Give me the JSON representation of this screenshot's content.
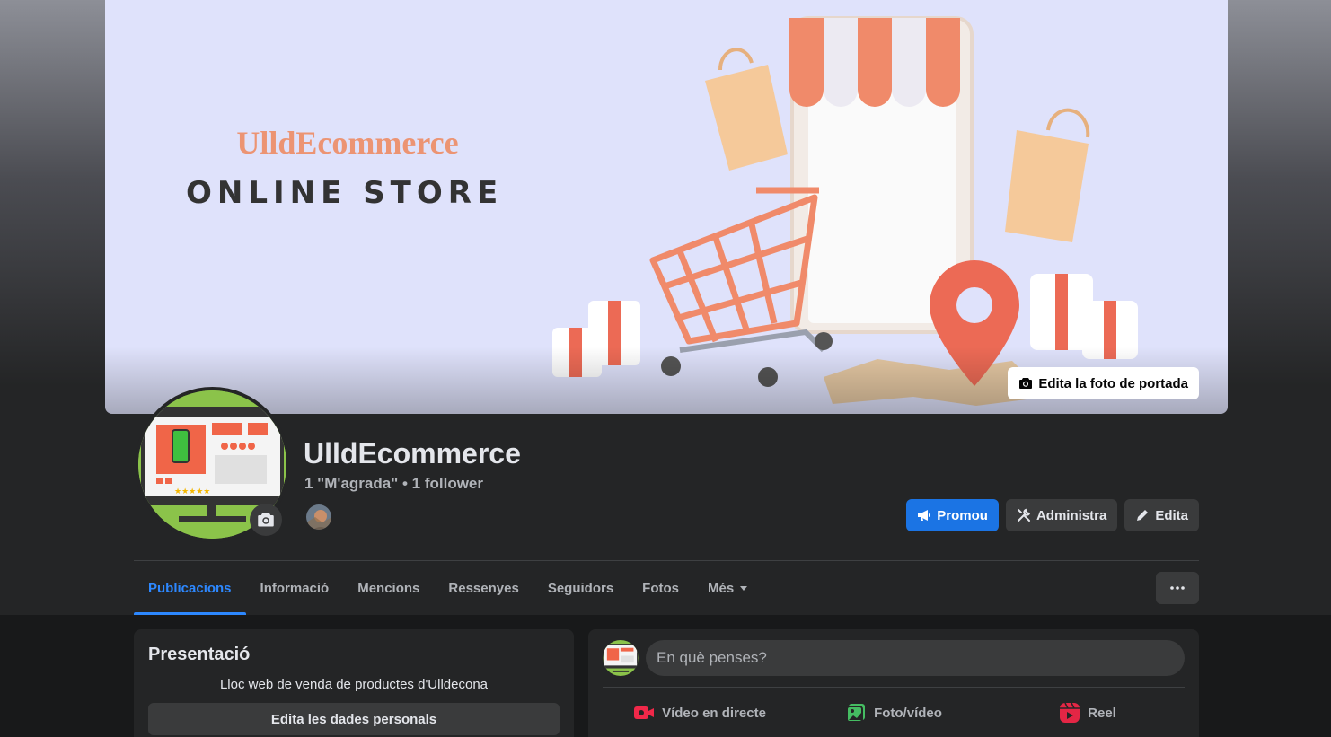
{
  "cover": {
    "brand": "UlldEcommerce",
    "tagline": "ONLINE STORE",
    "edit_button": "Edita la foto de portada"
  },
  "profile": {
    "name": "UlldEcommerce",
    "stats": "1 \"M'agrada\" • 1 follower"
  },
  "actions": {
    "promote": "Promou",
    "manage": "Administra",
    "edit": "Edita"
  },
  "tabs": [
    {
      "label": "Publicacions",
      "active": true
    },
    {
      "label": "Informació"
    },
    {
      "label": "Mencions"
    },
    {
      "label": "Ressenyes"
    },
    {
      "label": "Seguidors"
    },
    {
      "label": "Fotos"
    },
    {
      "label": "Més"
    }
  ],
  "intro": {
    "title": "Presentació",
    "description": "Lloc web de venda de productes d'Ulldecona",
    "edit_button": "Edita les dades personals"
  },
  "composer": {
    "placeholder": "En què penses?",
    "actions": {
      "live": "Vídeo en directe",
      "photo": "Foto/vídeo",
      "reel": "Reel"
    }
  },
  "colors": {
    "accent": "#2d88ff",
    "primary_button": "#1b74e4",
    "background": "#18191a",
    "surface": "#242526",
    "brand_orange": "#ec9473"
  }
}
